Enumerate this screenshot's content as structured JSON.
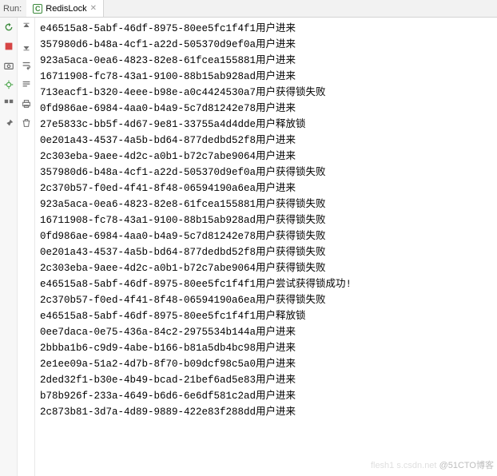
{
  "header": {
    "run_label": "Run:",
    "tab_label": "RedisLock"
  },
  "watermark": {
    "left": "flesh1 s.csdn.net",
    "right": "@51CTO博客"
  },
  "console_lines": [
    "e46515a8-5abf-46df-8975-80ee5fc1f4f1用户进来",
    "357980d6-b48a-4cf1-a22d-505370d9ef0a用户进来",
    "923a5aca-0ea6-4823-82e8-61fcea155881用户进来",
    "16711908-fc78-43a1-9100-88b15ab928ad用户进来",
    "713eacf1-b320-4eee-b98e-a0c4424530a7用户获得锁失败",
    "0fd986ae-6984-4aa0-b4a9-5c7d81242e78用户进来",
    "27e5833c-bb5f-4d67-9e81-33755a4d4dde用户释放锁",
    "0e201a43-4537-4a5b-bd64-877dedbd52f8用户进来",
    "2c303eba-9aee-4d2c-a0b1-b72c7abe9064用户进来",
    "357980d6-b48a-4cf1-a22d-505370d9ef0a用户获得锁失败",
    "2c370b57-f0ed-4f41-8f48-06594190a6ea用户进来",
    "923a5aca-0ea6-4823-82e8-61fcea155881用户获得锁失败",
    "16711908-fc78-43a1-9100-88b15ab928ad用户获得锁失败",
    "0fd986ae-6984-4aa0-b4a9-5c7d81242e78用户获得锁失败",
    "0e201a43-4537-4a5b-bd64-877dedbd52f8用户获得锁失败",
    "2c303eba-9aee-4d2c-a0b1-b72c7abe9064用户获得锁失败",
    "e46515a8-5abf-46df-8975-80ee5fc1f4f1用户尝试获得锁成功!",
    "2c370b57-f0ed-4f41-8f48-06594190a6ea用户获得锁失败",
    "e46515a8-5abf-46df-8975-80ee5fc1f4f1用户释放锁",
    "0ee7daca-0e75-436a-84c2-2975534b144a用户进来",
    "2bbba1b6-c9d9-4abe-b166-b81a5db4bc98用户进来",
    "2e1ee09a-51a2-4d7b-8f70-b09dcf98c5a0用户进来",
    "2ded32f1-b30e-4b49-bcad-21bef6ad5e83用户进来",
    "b78b926f-233a-4649-b6d6-6e6df581c2ad用户进来",
    "2c873b81-3d7a-4d89-9889-422e83f288dd用户进来"
  ]
}
